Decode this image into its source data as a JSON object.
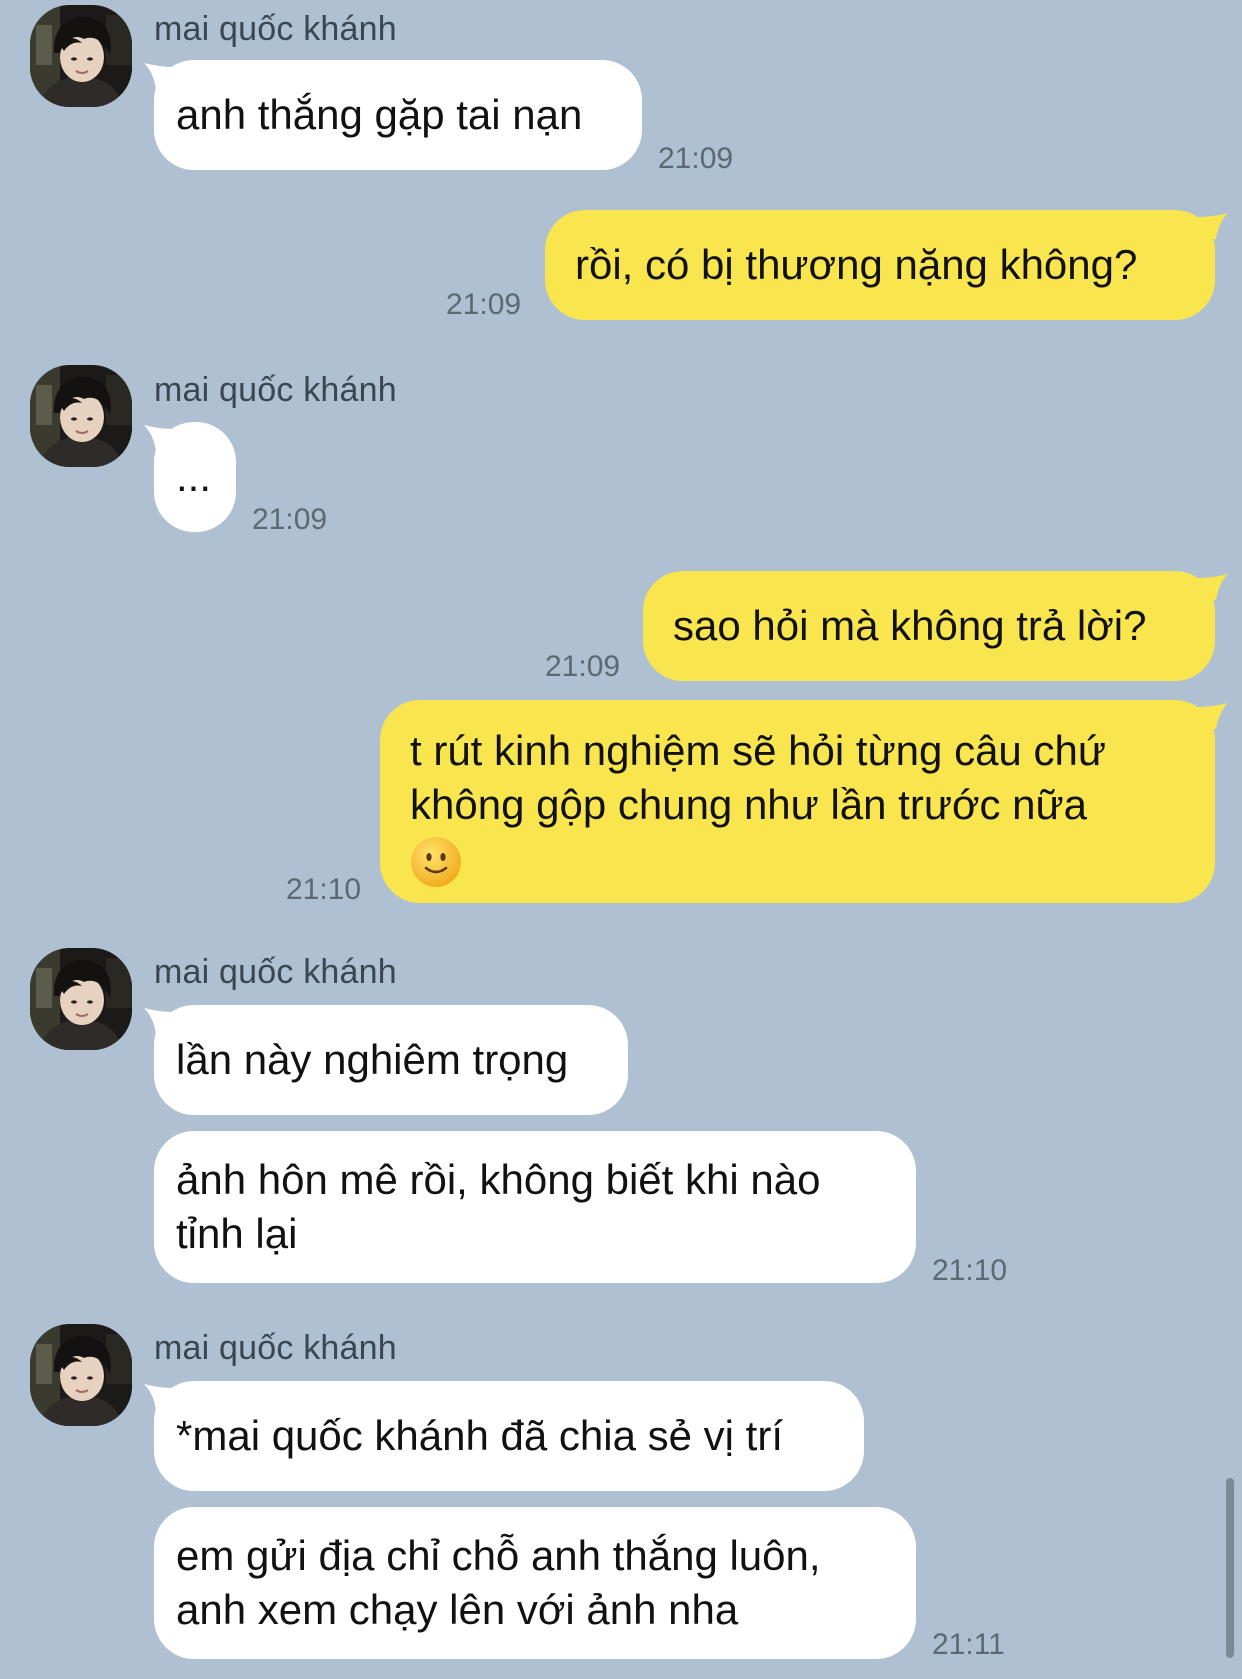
{
  "colors": {
    "background": "#aec0d1",
    "incoming_bubble": "#ffffff",
    "outgoing_bubble": "#f9e64f",
    "timestamp": "#5c6975"
  },
  "messages": [
    {
      "sender": "mai quốc khánh",
      "text": "anh thắng gặp tai nạn",
      "time": "21:09"
    },
    {
      "text": "rồi, có bị thương nặng không?",
      "time": "21:09"
    },
    {
      "sender": "mai quốc khánh",
      "text": "...",
      "time": "21:09"
    },
    {
      "text": "sao hỏi mà không trả lời?",
      "time": "21:09"
    },
    {
      "text_line1": "t rút kinh nghiệm sẽ hỏi từng câu chứ",
      "text_line2": "không gộp chung như lần trước nữa",
      "emoji": "slightly-smiling-face-icon",
      "time": "21:10"
    },
    {
      "sender": "mai quốc khánh",
      "text": "lần này nghiêm trọng"
    },
    {
      "text_line1": "ảnh hôn mê rồi, không biết khi nào",
      "text_line2": "tỉnh lại",
      "time": "21:10"
    },
    {
      "sender": "mai quốc khánh",
      "text": "*mai quốc khánh đã chia sẻ vị trí"
    },
    {
      "text_line1": "em gửi địa chỉ chỗ anh thắng luôn,",
      "text_line2": "anh xem chạy lên với ảnh nha",
      "time": "21:11"
    }
  ]
}
